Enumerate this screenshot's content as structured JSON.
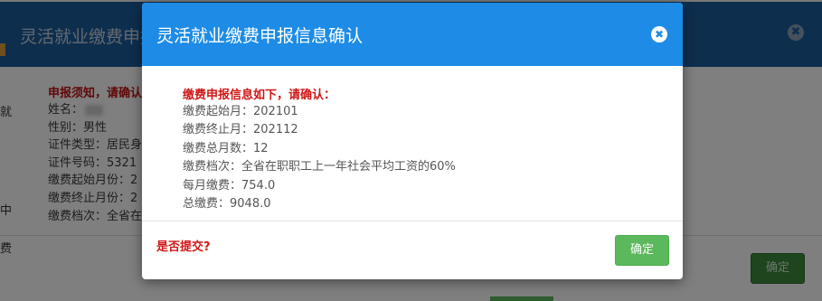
{
  "background_dialog": {
    "title": "灵活就业缴费申报",
    "close_glyph": "✖",
    "notice": "申报须知，请确认",
    "fields": [
      {
        "label": "姓名：",
        "value": ""
      },
      {
        "label": "性别：",
        "value": "男性"
      },
      {
        "label": "证件类型：",
        "value": "居民身"
      },
      {
        "label": "证件号码：",
        "value": "5321"
      },
      {
        "label": "缴费起始月份：",
        "value": "2"
      },
      {
        "label": "缴费终止月份：",
        "value": "2"
      },
      {
        "label": "缴费档次：",
        "value": "全省在"
      }
    ],
    "left_fragments": [
      "就",
      "中",
      "费"
    ],
    "confirm_label": "确定"
  },
  "modal": {
    "title": "灵活就业缴费申报信息确认",
    "close_glyph": "✖",
    "heading": "缴费申报信息如下，请确认：",
    "lines": [
      "缴费起始月：202101",
      "缴费终止月：202112",
      "缴费总月数：12",
      "缴费档次：全省在职职工上一年社会平均工资的60%",
      "每月缴费：754.0",
      "总缴费：9048.0"
    ],
    "question": "是否提交?",
    "confirm_label": "确定"
  },
  "colors": {
    "modal_header": "#1e8ce6",
    "background_header": "#1d5c9c",
    "emphasis_red": "#d01515",
    "confirm_green": "#5cb85c"
  }
}
